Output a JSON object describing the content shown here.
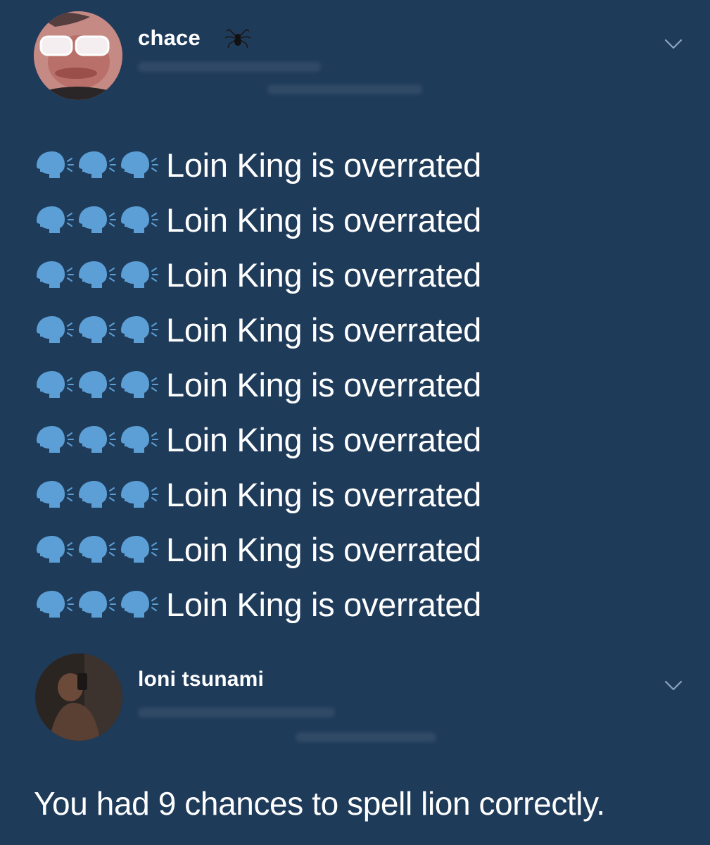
{
  "tweets": [
    {
      "display_name": "chace",
      "name_emoji_icon": "spider-icon",
      "menu_icon": "chevron-down-icon",
      "line_icon": "speaking-head-icon",
      "lines": [
        "Loin King is overrated",
        "Loin King is overrated",
        "Loin King is overrated",
        "Loin King is overrated",
        "Loin King is overrated",
        "Loin King is overrated",
        "Loin King is overrated",
        "Loin King is overrated",
        "Loin King is overrated"
      ]
    },
    {
      "display_name": "loni tsunami",
      "menu_icon": "chevron-down-icon",
      "text": "You had 9 chances to spell lion correctly."
    }
  ],
  "colors": {
    "background": "#1f3b5a",
    "text": "#ffffff",
    "emoji": "#5b9fd6",
    "chevron": "#8ba4bf"
  }
}
